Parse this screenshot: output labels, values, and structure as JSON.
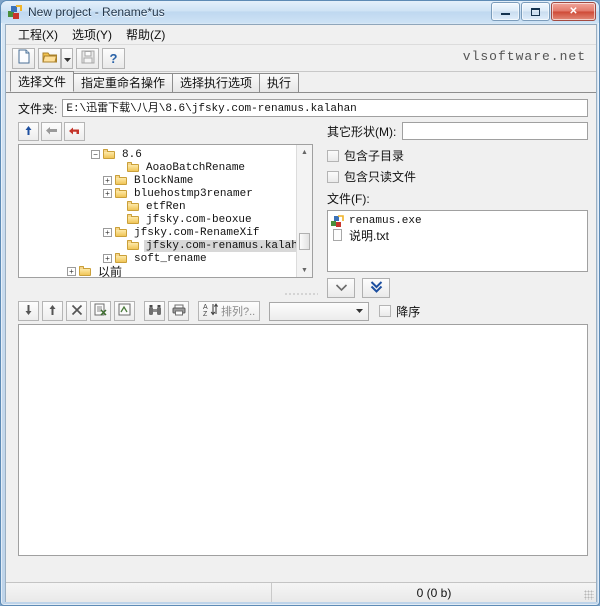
{
  "window": {
    "title": "New project - Rename*us",
    "icon": "app-icon",
    "buttons": {
      "minimize": "–",
      "maximize": "□",
      "close": "✕"
    }
  },
  "menubar": {
    "items": [
      {
        "label": "工程(X)",
        "name": "menu-project"
      },
      {
        "label": "选项(Y)",
        "name": "menu-options"
      },
      {
        "label": "帮助(Z)",
        "name": "menu-help"
      }
    ]
  },
  "toolbar": {
    "buttons": [
      {
        "name": "new-project-button",
        "icon": "new-document-icon"
      },
      {
        "name": "open-project-button",
        "icon": "open-folder-icon"
      },
      {
        "name": "open-dropdown-button",
        "icon": "chevron-down-icon"
      },
      {
        "name": "save-project-button",
        "icon": "save-disk-icon"
      },
      {
        "name": "help-button",
        "icon": "question-mark-icon"
      }
    ],
    "brand": "vlsoftware.net"
  },
  "tabs": [
    {
      "label": "选择文件",
      "name": "tab-select-files",
      "active": true
    },
    {
      "label": "指定重命名操作",
      "name": "tab-rename-actions",
      "active": false
    },
    {
      "label": "选择执行选项",
      "name": "tab-exec-options",
      "active": false
    },
    {
      "label": "执行",
      "name": "tab-execute",
      "active": false
    }
  ],
  "folder": {
    "label": "文件夹:",
    "value": "E:\\迅雷下载\\八月\\8.6\\jfsky.com-renamus.kalahan"
  },
  "nav_buttons": [
    {
      "name": "go-up-button",
      "icon": "up-arrow-icon"
    },
    {
      "name": "go-back-button",
      "icon": "left-arrow-icon"
    },
    {
      "name": "refresh-button",
      "icon": "refresh-arrow-icon"
    }
  ],
  "tree": {
    "nodes": [
      {
        "label": "8.6",
        "indent": 6,
        "expander": "−",
        "selected": false
      },
      {
        "label": "AoaoBatchRename",
        "indent": 8,
        "expander": "",
        "selected": false
      },
      {
        "label": "BlockName",
        "indent": 7,
        "expander": "+",
        "selected": false
      },
      {
        "label": "bluehostmp3renamer",
        "indent": 7,
        "expander": "+",
        "selected": false
      },
      {
        "label": "etfRen",
        "indent": 8,
        "expander": "",
        "selected": false
      },
      {
        "label": "jfsky.com-beoxue",
        "indent": 8,
        "expander": "",
        "selected": false
      },
      {
        "label": "jfsky.com-RenameXif",
        "indent": 7,
        "expander": "+",
        "selected": false
      },
      {
        "label": "jfsky.com-renamus.kalahan",
        "indent": 8,
        "expander": "",
        "selected": true
      },
      {
        "label": "soft_rename",
        "indent": 7,
        "expander": "+",
        "selected": false
      },
      {
        "label": "以前",
        "indent": 2,
        "expander": "+",
        "selected": false
      }
    ]
  },
  "right_panel": {
    "mask_label": "其它形状(M):",
    "mask_value": "",
    "mask_placeholder": "",
    "checkboxes": [
      {
        "label": "包含子目录",
        "name": "include-subdirs-checkbox",
        "checked": false
      },
      {
        "label": "包含只读文件",
        "name": "include-readonly-checkbox",
        "checked": false
      }
    ],
    "files_label": "文件(F):",
    "files": [
      {
        "name": "renamus.exe",
        "icon": "exe-icon",
        "cn": false
      },
      {
        "name": "说明.txt",
        "icon": "txt-icon",
        "cn": true
      }
    ],
    "add_buttons": [
      {
        "name": "add-selected-button",
        "icon": "chevron-down-icon"
      },
      {
        "name": "add-all-button",
        "icon": "double-chevron-down-icon"
      }
    ]
  },
  "list_toolbar": {
    "buttons": [
      {
        "name": "move-down-button",
        "icon": "down-arrow-icon"
      },
      {
        "name": "move-up-button",
        "icon": "up-arrow-icon"
      },
      {
        "name": "remove-button",
        "icon": "cross-icon"
      },
      {
        "name": "remove-all-button",
        "icon": "clear-list-icon"
      },
      {
        "name": "edit-entry-button",
        "icon": "edit-icon"
      },
      {
        "name": "find-button",
        "icon": "binoculars-icon"
      },
      {
        "name": "print-button",
        "icon": "printer-icon"
      }
    ],
    "sort_button": {
      "label": "排列?..",
      "name": "sort-button",
      "icon": "sort-az-icon"
    },
    "sort_combo_value": "",
    "descending": {
      "label": "降序",
      "name": "descending-checkbox",
      "checked": false
    }
  },
  "statusbar": {
    "left": "",
    "count": "0  (0 b)"
  }
}
